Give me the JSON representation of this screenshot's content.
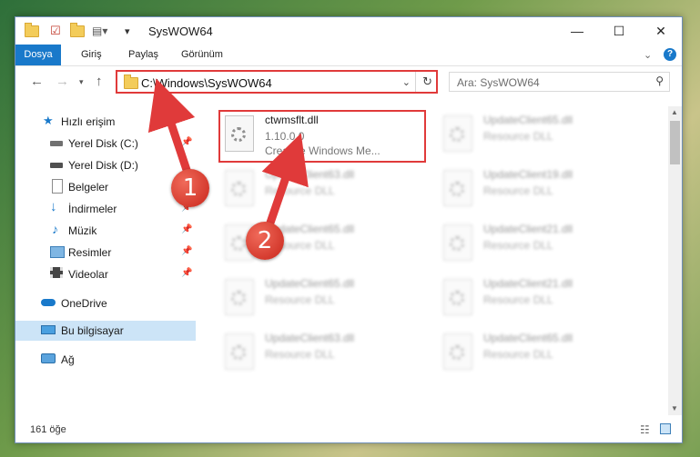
{
  "window": {
    "title": "SysWOW64",
    "controls": {
      "minimize": "—",
      "maximize": "☐",
      "close": "✕"
    }
  },
  "ribbon": {
    "tabs": [
      "Dosya",
      "Giriş",
      "Paylaş",
      "Görünüm"
    ]
  },
  "navbar": {
    "address": "C:\\Windows\\SysWOW64",
    "search_placeholder": "Ara: SysWOW64"
  },
  "sidebar": {
    "items": [
      {
        "label": "Hızlı erişim",
        "icon": "star-icon"
      },
      {
        "label": "Yerel Disk (C:)",
        "icon": "drive-icon",
        "pinned": true
      },
      {
        "label": "Yerel Disk (D:)",
        "icon": "drive-icon"
      },
      {
        "label": "Belgeler",
        "icon": "document-icon",
        "pinned": true
      },
      {
        "label": "İndirmeler",
        "icon": "download-icon",
        "pinned": true
      },
      {
        "label": "Müzik",
        "icon": "music-icon",
        "pinned": true
      },
      {
        "label": "Resimler",
        "icon": "image-icon",
        "pinned": true
      },
      {
        "label": "Videolar",
        "icon": "video-icon",
        "pinned": true
      },
      {
        "label": "OneDrive",
        "icon": "cloud-icon"
      },
      {
        "label": "Bu bilgisayar",
        "icon": "computer-icon",
        "selected": true
      },
      {
        "label": "Ağ",
        "icon": "network-icon"
      }
    ]
  },
  "files": [
    {
      "name": "ctwmsflt.dll",
      "line2": "1.10.0.0",
      "line3": "Creative Windows Me..."
    },
    {
      "name": "UpdateClient65.dll",
      "line2": "Resource DLL"
    },
    {
      "name": "UpdateClient63.dll",
      "line2": "Resource DLL"
    },
    {
      "name": "UpdateClient19.dll",
      "line2": "Resource DLL"
    },
    {
      "name": "UpdateClient65.dll",
      "line2": "Resource DLL"
    },
    {
      "name": "UpdateClient21.dll",
      "line2": "Resource DLL"
    },
    {
      "name": "UpdateClient65.dll",
      "line2": "Resource DLL"
    },
    {
      "name": "UpdateClient21.dll",
      "line2": "Resource DLL"
    },
    {
      "name": "UpdateClient63.dll",
      "line2": "Resource DLL"
    },
    {
      "name": "UpdateClient65.dll",
      "line2": "Resource DLL"
    }
  ],
  "status": {
    "item_count": "161 öğe"
  },
  "callouts": [
    "1",
    "2"
  ],
  "colors": {
    "accent": "#1979ca",
    "highlight": "#e03a3a"
  }
}
